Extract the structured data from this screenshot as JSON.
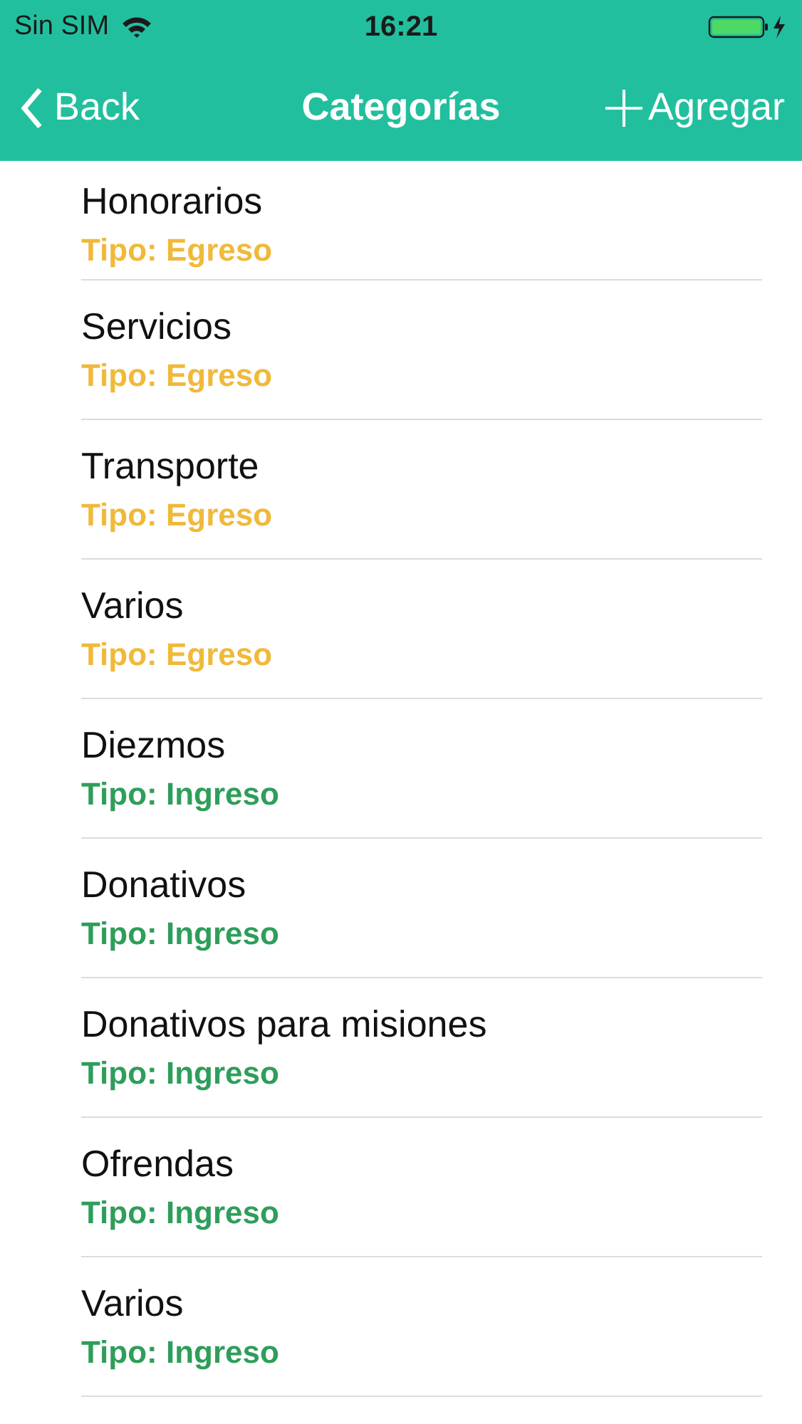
{
  "status_bar": {
    "carrier": "Sin SIM",
    "time": "16:21"
  },
  "nav_bar": {
    "back": "Back",
    "title": "Categorías",
    "add": "Agregar"
  },
  "categories": [
    {
      "name": "Honorarios",
      "type": "Tipo: Egreso",
      "color": "#f0b93a"
    },
    {
      "name": "Servicios",
      "type": "Tipo: Egreso",
      "color": "#f0b93a"
    },
    {
      "name": "Transporte",
      "type": "Tipo: Egreso",
      "color": "#f0b93a"
    },
    {
      "name": "Varios",
      "type": "Tipo: Egreso",
      "color": "#f0b93a"
    },
    {
      "name": "Diezmos",
      "type": "Tipo: Ingreso",
      "color": "#2e9e5a"
    },
    {
      "name": "Donativos",
      "type": "Tipo: Ingreso",
      "color": "#2e9e5a"
    },
    {
      "name": "Donativos para misiones",
      "type": "Tipo: Ingreso",
      "color": "#2e9e5a"
    },
    {
      "name": "Ofrendas",
      "type": "Tipo: Ingreso",
      "color": "#2e9e5a"
    },
    {
      "name": "Varios",
      "type": "Tipo: Ingreso",
      "color": "#2e9e5a"
    }
  ]
}
